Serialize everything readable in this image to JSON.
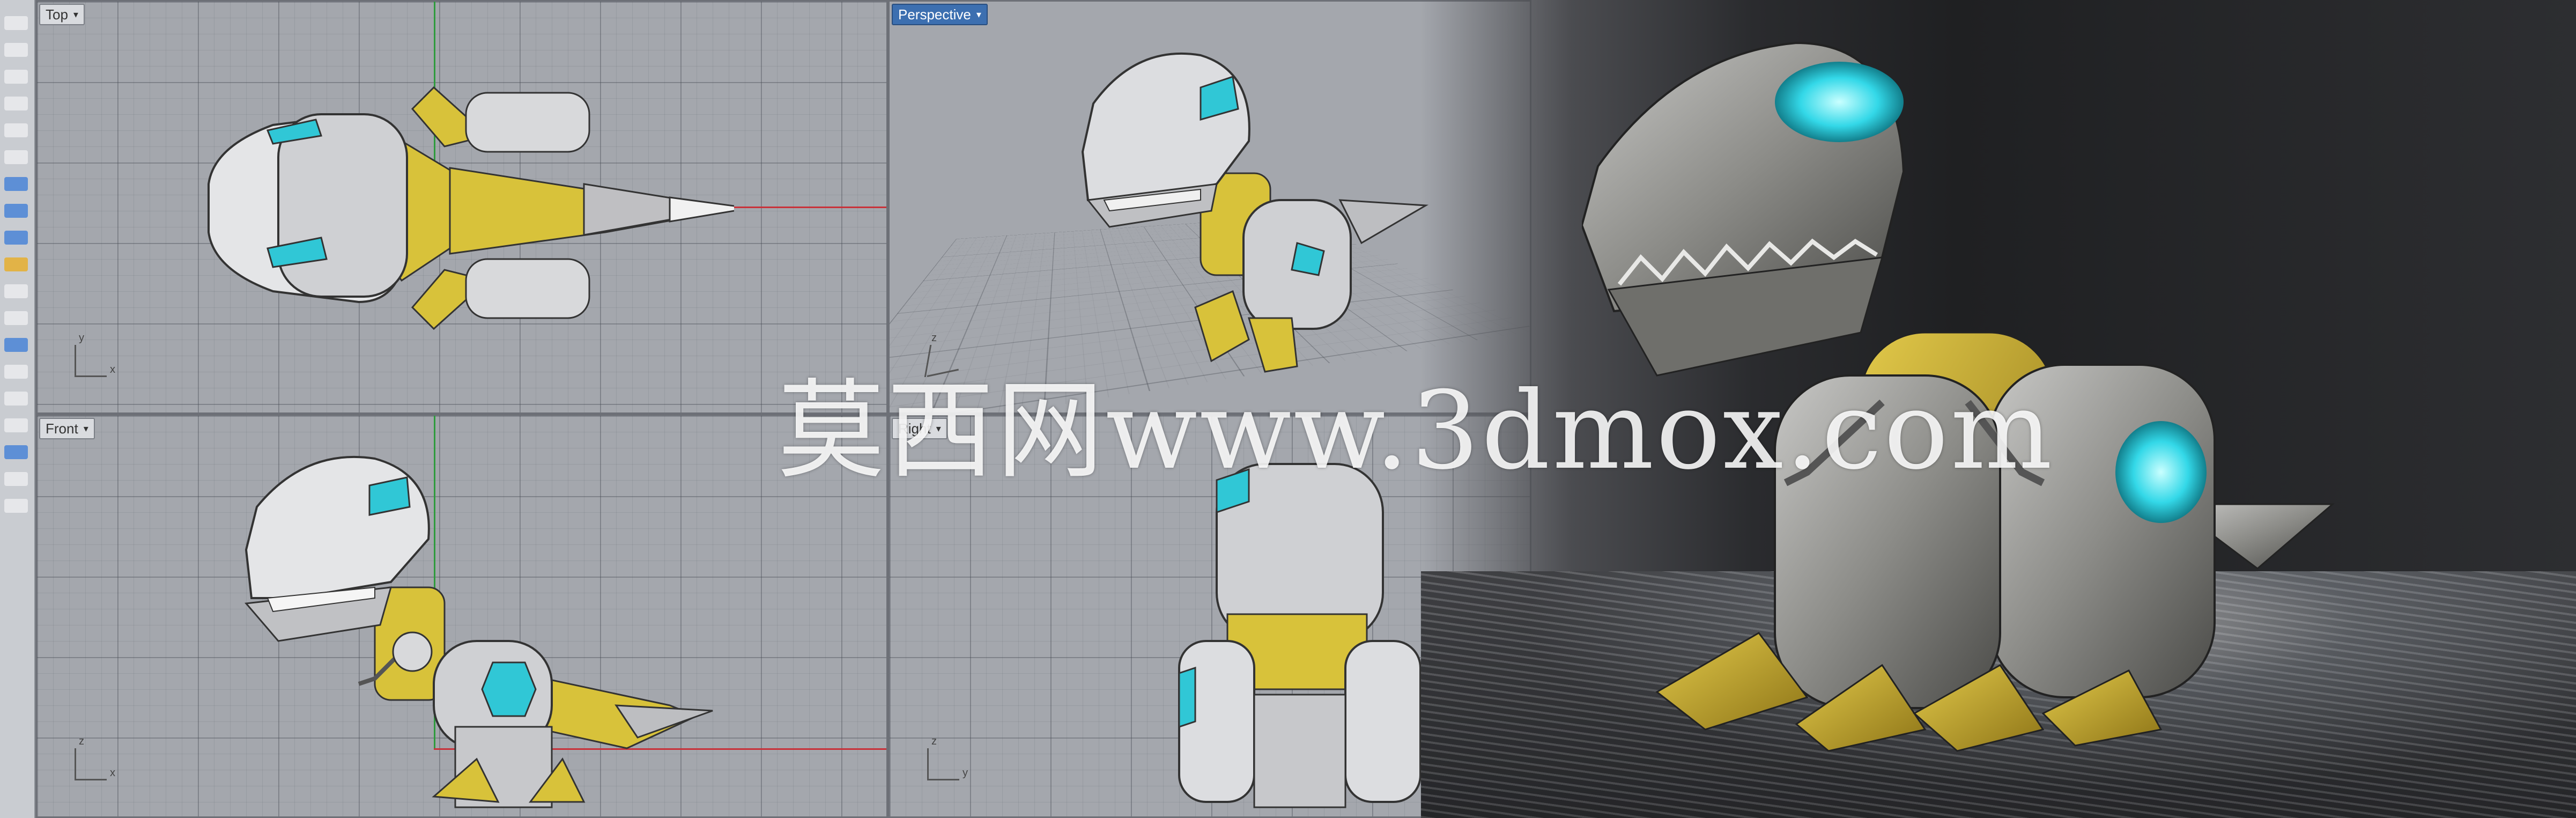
{
  "viewports": {
    "top": {
      "label": "Top"
    },
    "perspective": {
      "label": "Perspective"
    },
    "front": {
      "label": "Front"
    },
    "right": {
      "label": "Right"
    }
  },
  "axes": {
    "x": "x",
    "y": "y",
    "z": "z"
  },
  "watermark": {
    "text": "莫西网www.3dmox.com"
  },
  "colors": {
    "viewport_bg": "#a4a7ad",
    "active_tab": "#3c6fb0",
    "model_gray": "#d8d9db",
    "model_yellow": "#d8c23a",
    "model_cyan": "#30c7d6",
    "axis_red": "#c8323a",
    "axis_green": "#2f9b3e"
  }
}
